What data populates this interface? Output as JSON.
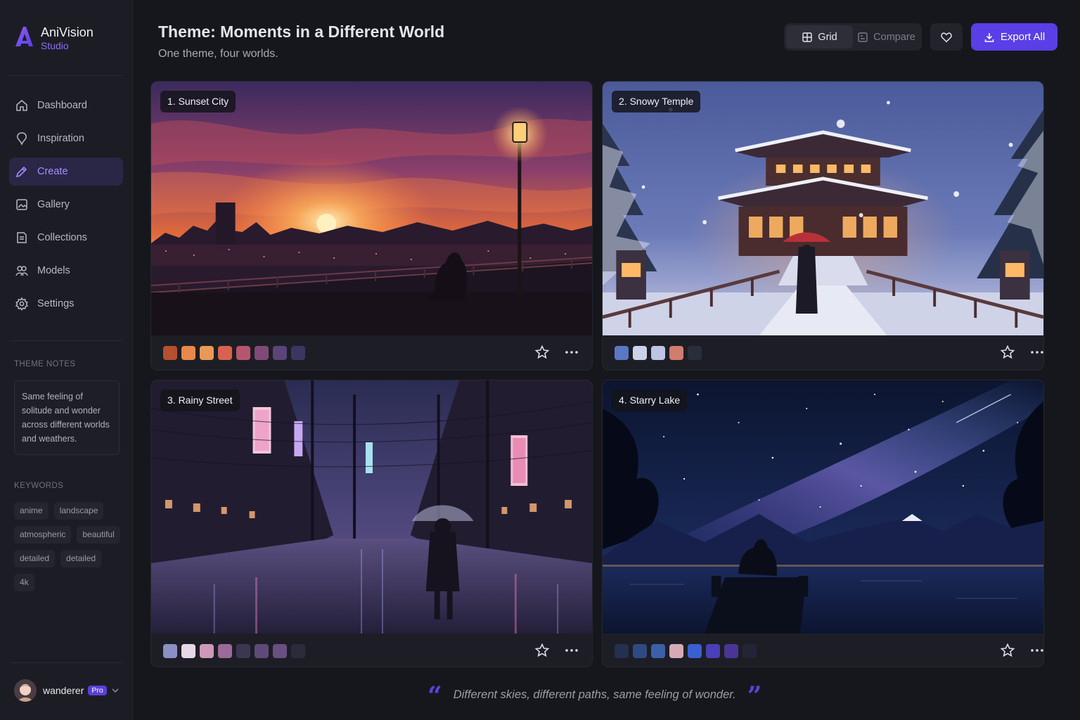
{
  "app": {
    "name": "AniVision",
    "sub": "Studio"
  },
  "nav": [
    {
      "label": "Dashboard",
      "icon": "home-icon"
    },
    {
      "label": "Inspiration",
      "icon": "bulb-icon"
    },
    {
      "label": "Create",
      "icon": "pencil-icon",
      "active": true
    },
    {
      "label": "Gallery",
      "icon": "image-icon"
    },
    {
      "label": "Collections",
      "icon": "folder-icon"
    },
    {
      "label": "Models",
      "icon": "models-icon"
    },
    {
      "label": "Settings",
      "icon": "gear-icon"
    }
  ],
  "theme_notes": {
    "label": "THEME NOTES",
    "text": "Same feeling of solitude and wonder across different worlds and weathers."
  },
  "keywords": {
    "label": "KEYWORDS",
    "items": [
      "anime",
      "landscape",
      "atmospheric",
      "beautiful",
      "detailed",
      "detailed",
      "4k"
    ]
  },
  "user": {
    "name": "wanderer",
    "badge": "Pro"
  },
  "header": {
    "title": "Theme: Moments in a Different World",
    "subtitle": "One theme, four worlds.",
    "grid_label": "Grid",
    "compare_label": "Compare",
    "export_label": "Export All"
  },
  "cards": [
    {
      "title": "1. Sunset City",
      "swatches": [
        "#b4502e",
        "#e8884a",
        "#e99856",
        "#d8624f",
        "#b8556e",
        "#7f4a78",
        "#5a4478",
        "#3b3560"
      ]
    },
    {
      "title": "2. Snowy Temple",
      "swatches": [
        "#5b78c4",
        "#cbd3e8",
        "#bcc5e2",
        "#d07c6e",
        "#2a2d3c"
      ]
    },
    {
      "title": "3. Rainy Street",
      "swatches": [
        "#8b8fc2",
        "#e6d8e6",
        "#cf97b8",
        "#9b6a98",
        "#3a3654",
        "#5e4a78",
        "#6a4f82",
        "#2c2b3c"
      ]
    },
    {
      "title": "4. Starry Lake",
      "swatches": [
        "#243050",
        "#2f4a82",
        "#3c5fa8",
        "#d6a9b6",
        "#3a5fd0",
        "#4a3fb8",
        "#4a3596",
        "#232536"
      ]
    }
  ],
  "quote": {
    "open": "“",
    "text": "Different skies, different paths, same feeling of wonder.",
    "close": "”"
  }
}
